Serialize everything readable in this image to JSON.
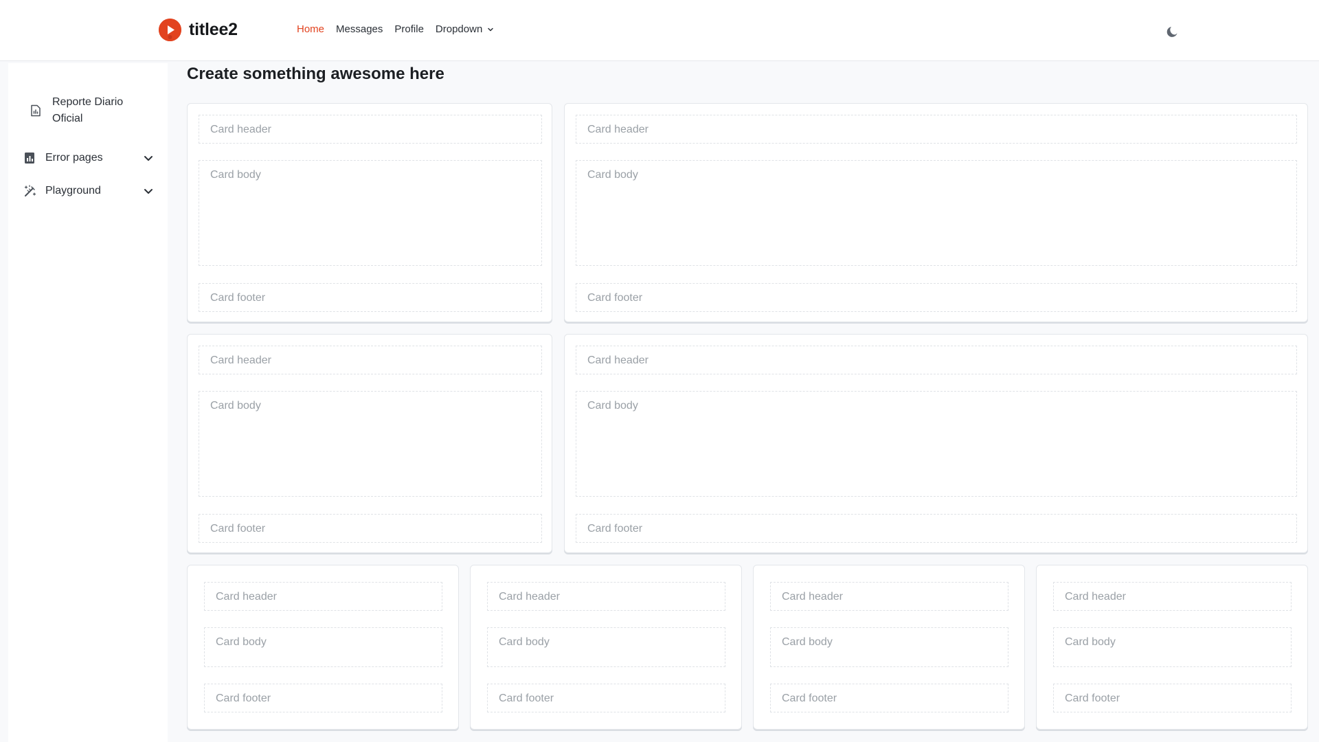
{
  "header": {
    "brand_title": "titlee2",
    "nav": [
      {
        "label": "Home",
        "active": true
      },
      {
        "label": "Messages",
        "active": false
      },
      {
        "label": "Profile",
        "active": false
      },
      {
        "label": "Dropdown",
        "active": false,
        "has_menu": true
      }
    ],
    "theme_toggle_icon": "moon-icon",
    "accent_color": "#e2431f"
  },
  "sidebar": {
    "items": [
      {
        "label": "Reporte Diario Oficial",
        "icon": "report-icon",
        "expandable": false
      },
      {
        "label": "Error pages",
        "icon": "bar-chart-icon",
        "expandable": true
      },
      {
        "label": "Playground",
        "icon": "magic-wand-icon",
        "expandable": true
      }
    ]
  },
  "main": {
    "title": "Create something awesome here",
    "cards": [
      {
        "header": "Card header",
        "body": "Card body",
        "footer": "Card footer"
      },
      {
        "header": "Card header",
        "body": "Card body",
        "footer": "Card footer"
      },
      {
        "header": "Card header",
        "body": "Card body",
        "footer": "Card footer"
      },
      {
        "header": "Card header",
        "body": "Card body",
        "footer": "Card footer"
      },
      {
        "header": "Card header",
        "body": "Card body",
        "footer": "Card footer"
      },
      {
        "header": "Card header",
        "body": "Card body",
        "footer": "Card footer"
      },
      {
        "header": "Card header",
        "body": "Card body",
        "footer": "Card footer"
      },
      {
        "header": "Card header",
        "body": "Card body",
        "footer": "Card footer"
      }
    ]
  }
}
